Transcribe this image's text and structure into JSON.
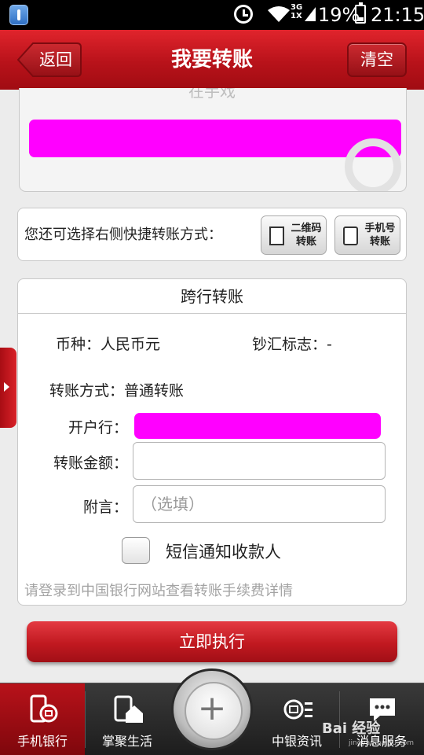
{
  "status_bar": {
    "network": "3G",
    "network2": "1X",
    "battery": "19%",
    "time": "21:15"
  },
  "header": {
    "back_label": "返回",
    "title": "我要转账",
    "clear_label": "清空"
  },
  "top_panel": {
    "partial_label": "在手戏"
  },
  "shortcut": {
    "text": "您还可选择右侧快捷转账方式：",
    "qr_label_line1": "二维码",
    "qr_label_line2": "转账",
    "phone_label_line1": "手机号",
    "phone_label_line2": "转账"
  },
  "form": {
    "section_title": "跨行转账",
    "currency": "币种：人民币元",
    "cash_flag": "钞汇标志：-",
    "transfer_method": "转账方式：普通转账",
    "bank_label": "开户行：",
    "amount_label": "转账金额：",
    "memo_label": "附言：",
    "memo_placeholder": "（选填）",
    "sms_label": "短信通知收款人",
    "fee_hint": "请登录到中国银行网站查看转账手续费详情"
  },
  "submit_label": "立即执行",
  "bottom_nav": {
    "items": [
      {
        "label": "手机银行",
        "icon": "mobile-bank-icon"
      },
      {
        "label": "掌聚生活",
        "icon": "home-life-icon"
      },
      {
        "label": "中银资讯",
        "icon": "boc-news-icon"
      },
      {
        "label": "消息服务",
        "icon": "message-icon"
      }
    ],
    "center_icon": "plus-icon"
  },
  "watermark": {
    "text": "Bai 经验",
    "sub": "jingyan.baidu.com"
  },
  "colors": {
    "brand_red": "#b8121a",
    "redaction": "#ff00ff"
  }
}
